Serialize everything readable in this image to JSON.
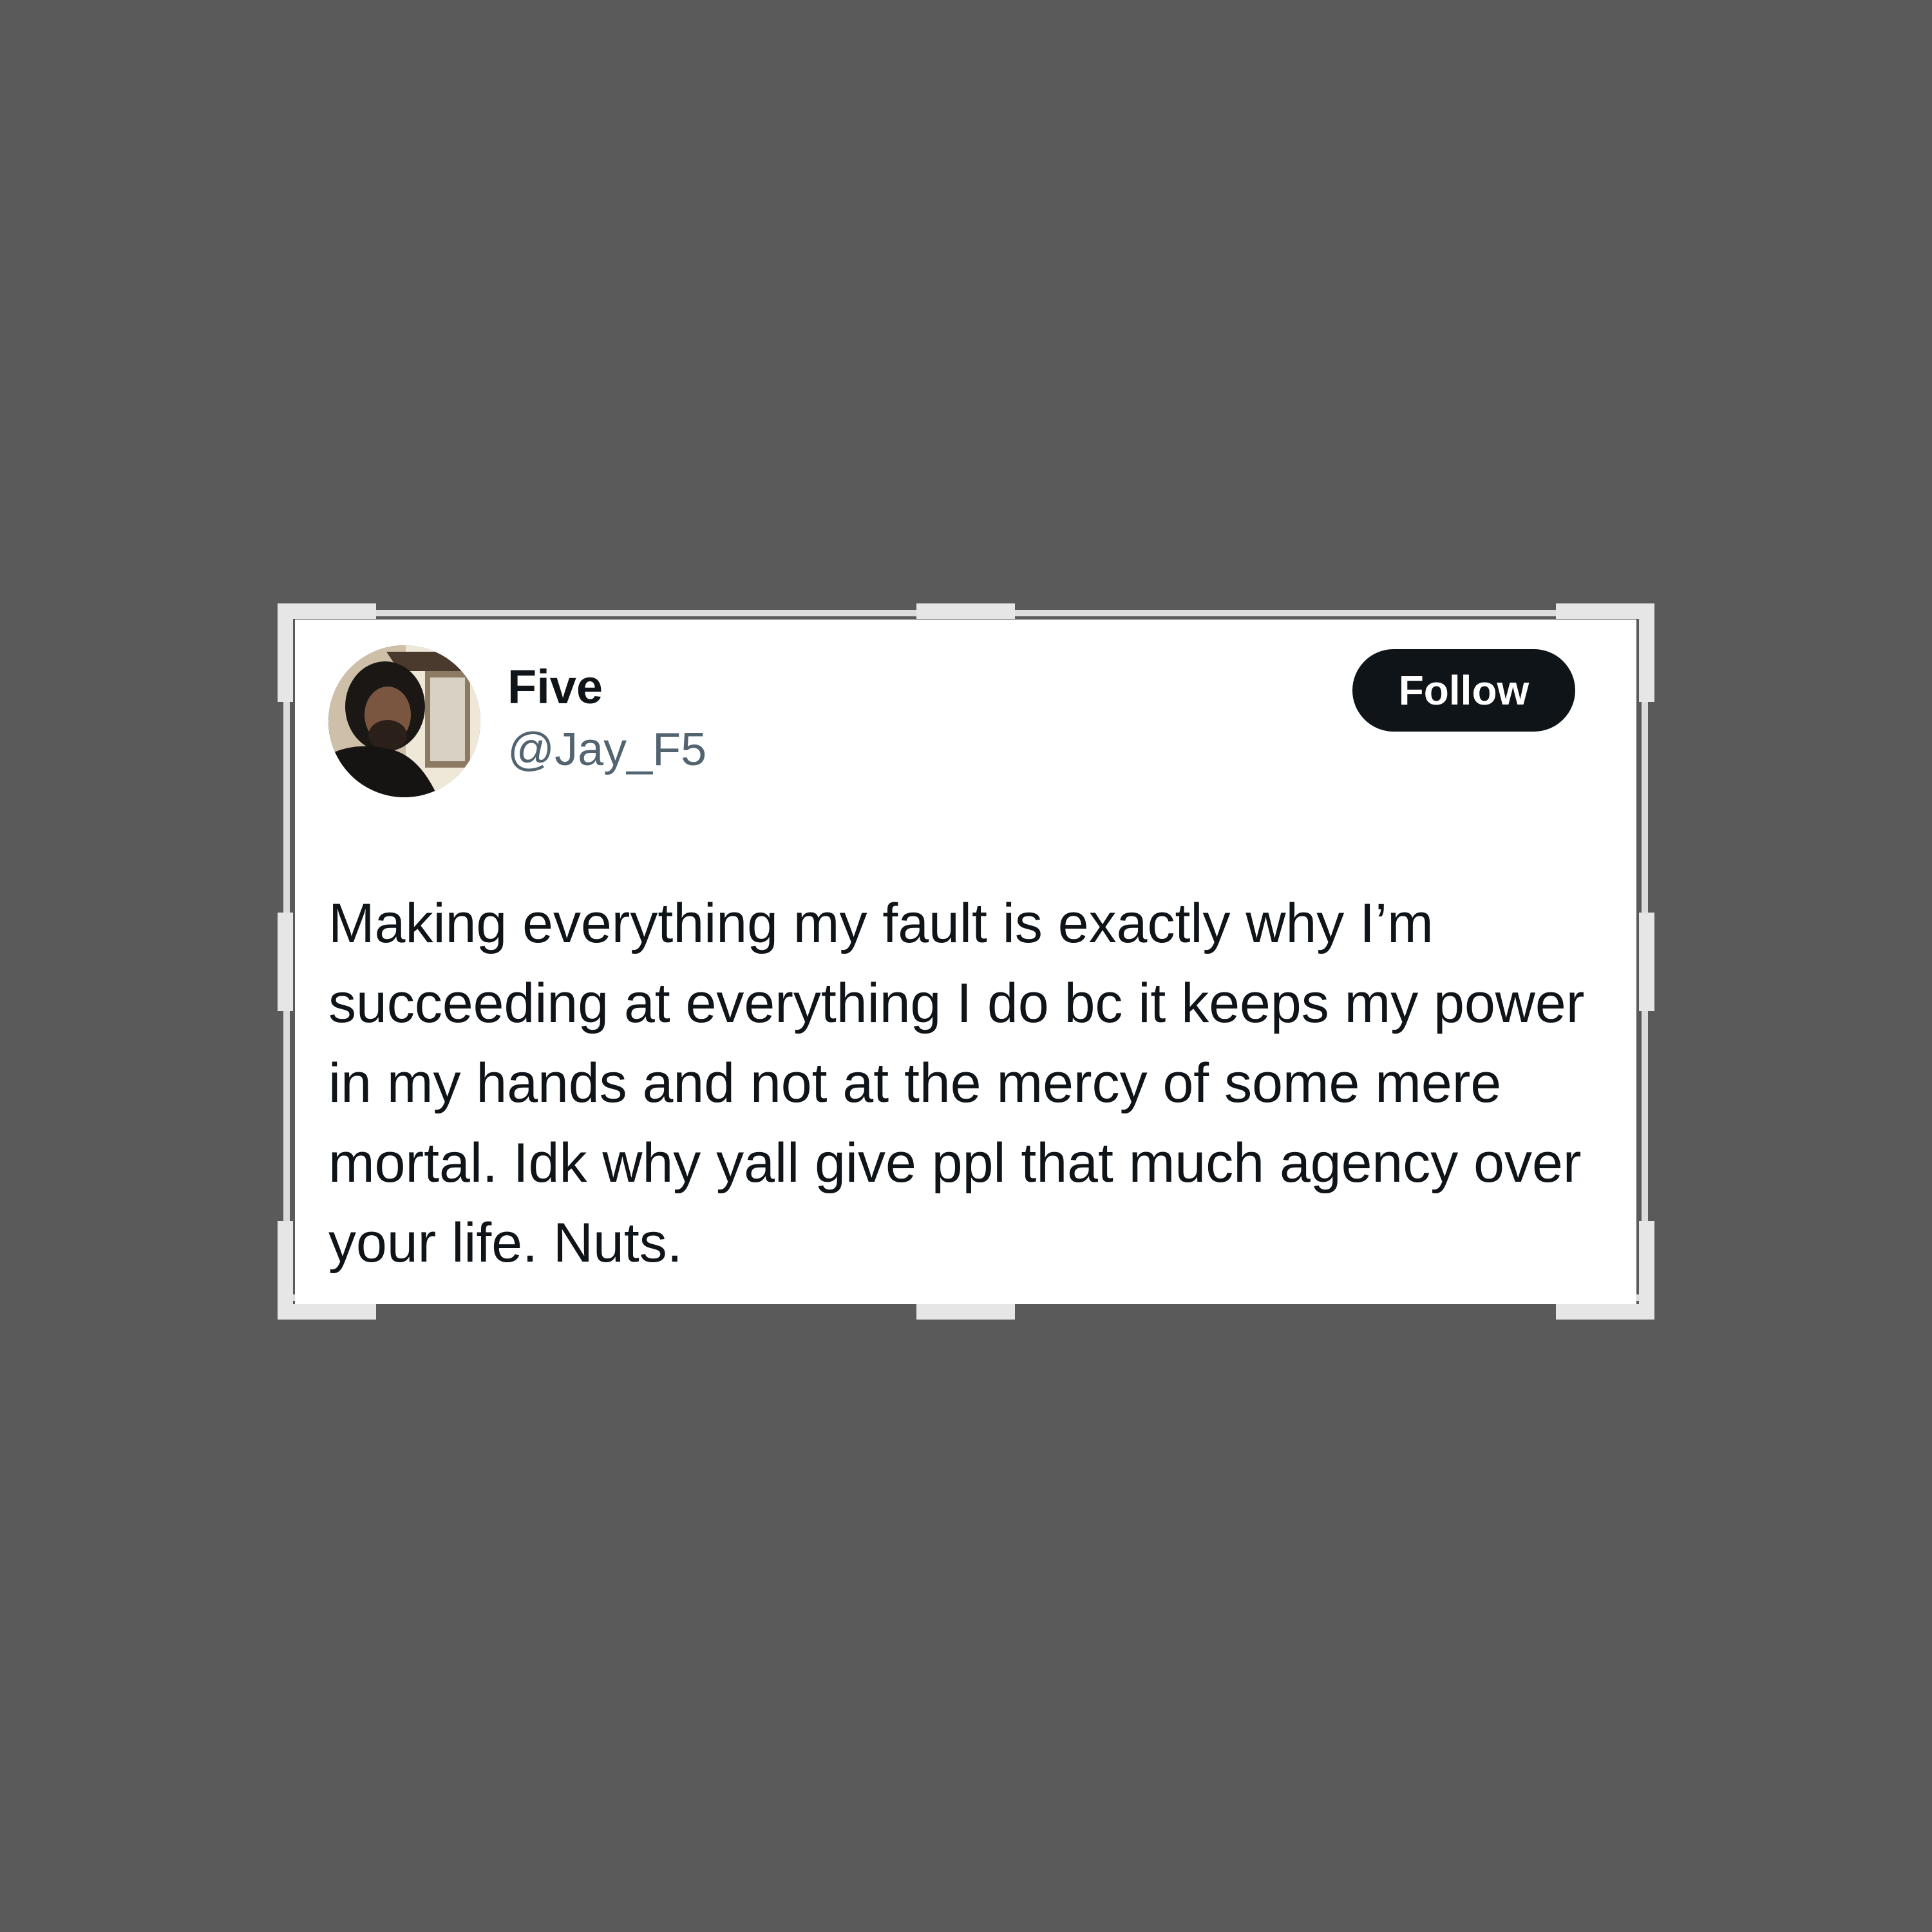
{
  "tweet": {
    "display_name": "Five",
    "username": "@Jay_F5",
    "follow_label": "Follow",
    "text": "Making everything my fault is exactly why I’m succeeding at everything I do bc it keeps my power in my hands and not at the mercy of some mere mortal. Idk why yall give ppl that much agency over your life. Nuts.",
    "avatar_icon": "profile-photo"
  },
  "colors": {
    "background": "#5a5a5a",
    "card": "#ffffff",
    "text_primary": "#0f1419",
    "text_secondary": "#536471",
    "follow_button": "#0f1419",
    "crop_handles": "#e6e6e6"
  }
}
